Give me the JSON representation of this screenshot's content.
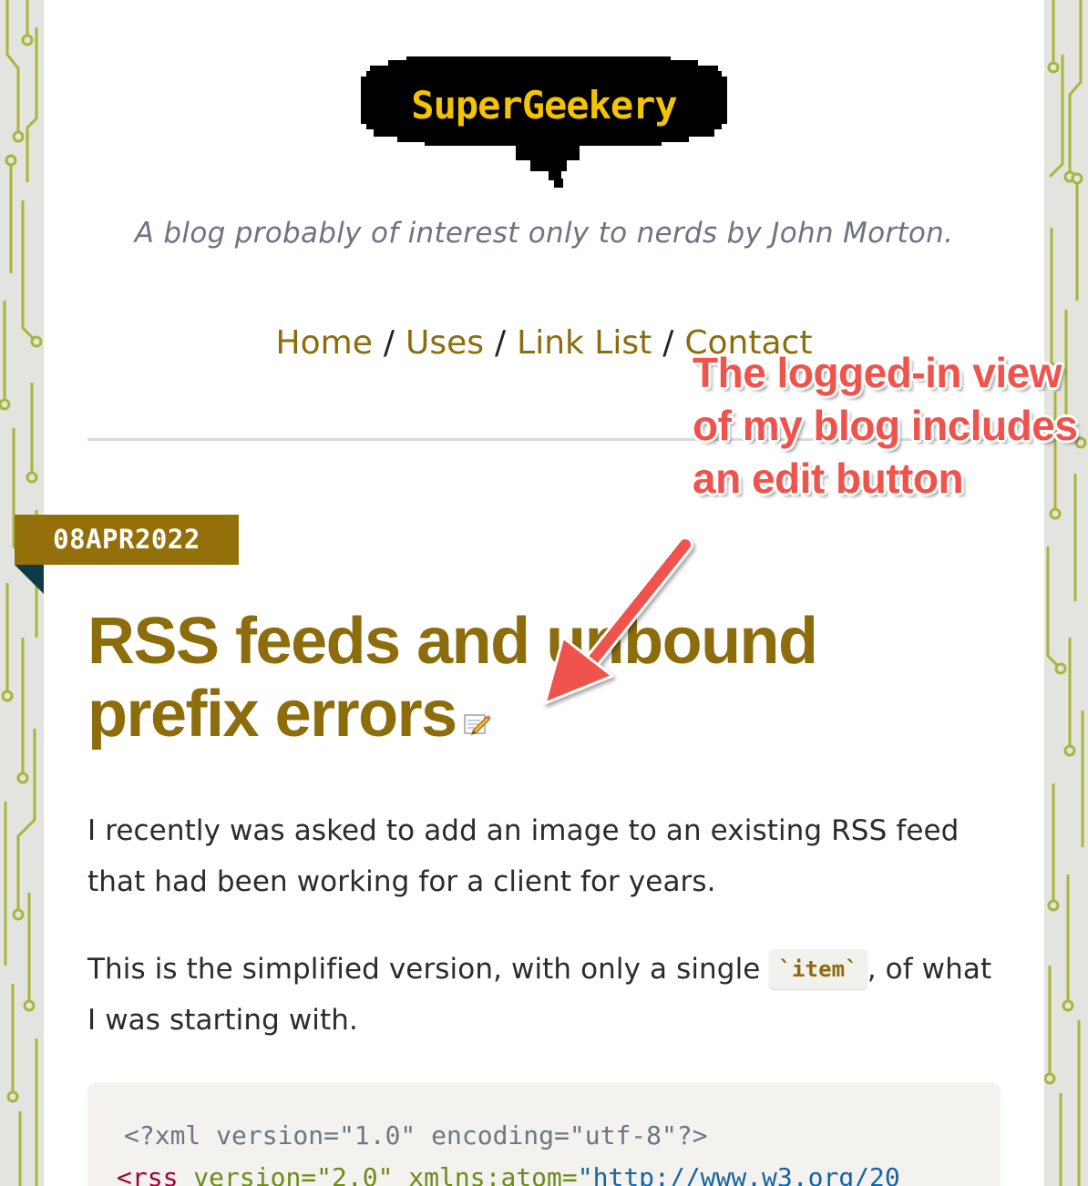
{
  "site": {
    "logo_text": "SuperGeekery",
    "tagline": "A blog probably of interest only to nerds by John Morton."
  },
  "nav": {
    "items": [
      {
        "label": "Home"
      },
      {
        "label": "Uses"
      },
      {
        "label": "Link List"
      },
      {
        "label": "Contact"
      }
    ],
    "separator": "/"
  },
  "post": {
    "date": "08APR2022",
    "title": "RSS feeds and unbound prefix errors",
    "paragraph1": "I recently was asked to add an image to an existing RSS feed that had been working for a client for years.",
    "paragraph2_before": "This is the simplified version, with only a single ",
    "paragraph2_code": "`item`",
    "paragraph2_after": ", of what I was starting with.",
    "code": {
      "line1": "<?xml version=\"1.0\" encoding=\"utf-8\"?>",
      "line2_tag": "<rss",
      "line2_attr1": " version=",
      "line2_val1": "\"2.0\"",
      "line2_attr2": " xmlns:atom=",
      "line2_val2": "\"http://www.w3.org/20"
    }
  },
  "annotation": {
    "text": "The logged-in view of my blog includes an edit button"
  },
  "icons": {
    "edit": "edit-pencil-icon"
  },
  "colors": {
    "accent": "#8c6c0b",
    "badge": "#93700a",
    "annotation": "#f0524c",
    "logo_text": "#f5c400"
  }
}
